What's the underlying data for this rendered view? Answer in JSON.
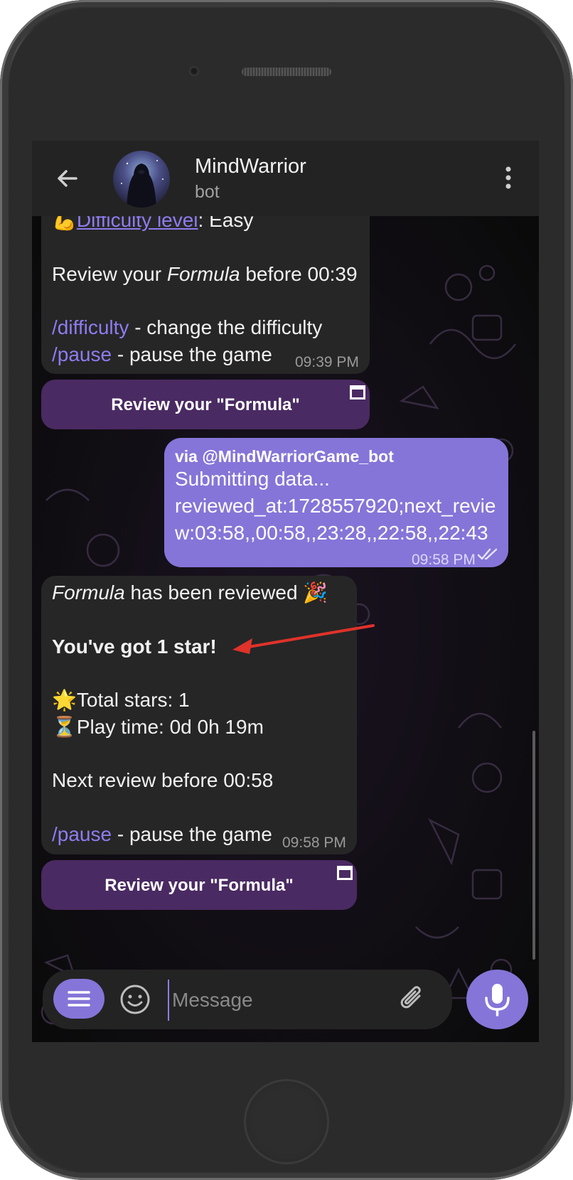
{
  "header": {
    "title": "MindWarrior",
    "subtitle": "bot"
  },
  "messages": {
    "first": {
      "difficulty_emoji": "💪",
      "difficulty_link": "Difficulty level",
      "difficulty_value": ": Easy",
      "review_prefix": "Review your ",
      "review_italic": "Formula",
      "review_suffix": " before 00:39",
      "cmd_difficulty": "/difficulty",
      "cmd_difficulty_desc": " - change the difficulty",
      "cmd_pause": "/pause",
      "cmd_pause_desc": " - pause the game",
      "time": "09:39 PM",
      "button_label": "Review your \"Formula\""
    },
    "outgoing": {
      "via": "via @MindWarriorGame_bot",
      "line1": "Submitting data...",
      "line2": "reviewed_at:1728557920;next_revie",
      "line3": "w:03:58,,00:58,,23:28,,22:58,,22:43",
      "time": "09:58 PM",
      "status_icon": "double-check-icon"
    },
    "second": {
      "italic": "Formula",
      "reviewed_text": " has been reviewed ",
      "party_emoji": "🎉",
      "stars_heading": "You've got 1 star!",
      "stars_emoji": "🌟",
      "total_stars": "Total stars: 1",
      "hourglass_emoji": "⏳",
      "play_time": "Play time: 0d 0h 19m",
      "next_review": "Next review before 00:58",
      "cmd_pause": "/pause",
      "cmd_pause_desc": " - pause the game",
      "time": "09:58 PM",
      "button_label": "Review your \"Formula\""
    }
  },
  "composer": {
    "placeholder": "Message"
  },
  "colors": {
    "accent": "#8575d8",
    "link": "#8e7cf0",
    "bubble_in": "#262626",
    "inline_button": "#4a2a62",
    "annotation_arrow": "#e0322a"
  }
}
